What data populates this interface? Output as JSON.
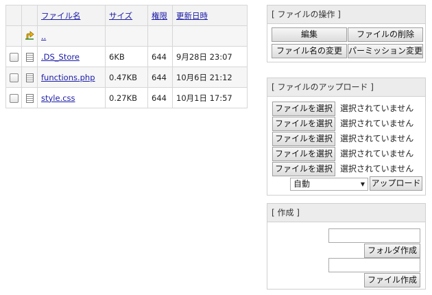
{
  "table": {
    "headers": {
      "name": "ファイル名",
      "size": "サイズ",
      "perm": "権限",
      "date": "更新日時"
    },
    "parent_link": "..",
    "rows": [
      {
        "name": ".DS_Store",
        "size": "6KB",
        "perm": "644",
        "date": "9月28日 23:07"
      },
      {
        "name": "functions.php",
        "size": "0.47KB",
        "perm": "644",
        "date": "10月6日 21:12"
      },
      {
        "name": "style.css",
        "size": "0.27KB",
        "perm": "644",
        "date": "10月1日 17:57"
      }
    ]
  },
  "operations": {
    "title": "[ ファイルの操作 ]",
    "edit": "編集",
    "delete": "ファイルの削除",
    "rename": "ファイル名の変更",
    "permission": "パーミッション変更"
  },
  "upload": {
    "title": "[ ファイルのアップロード ]",
    "choose_label": "ファイルを選択",
    "no_file": "選択されていません",
    "mode_value": "自動",
    "submit": "アップロード"
  },
  "create": {
    "title": "[ 作成 ]",
    "folder_button": "フォルダ作成",
    "file_button": "ファイル作成"
  },
  "colors": {
    "link": "#1a1aa6",
    "panel_header": "#ececec",
    "folder_icon": "#f0b400"
  }
}
